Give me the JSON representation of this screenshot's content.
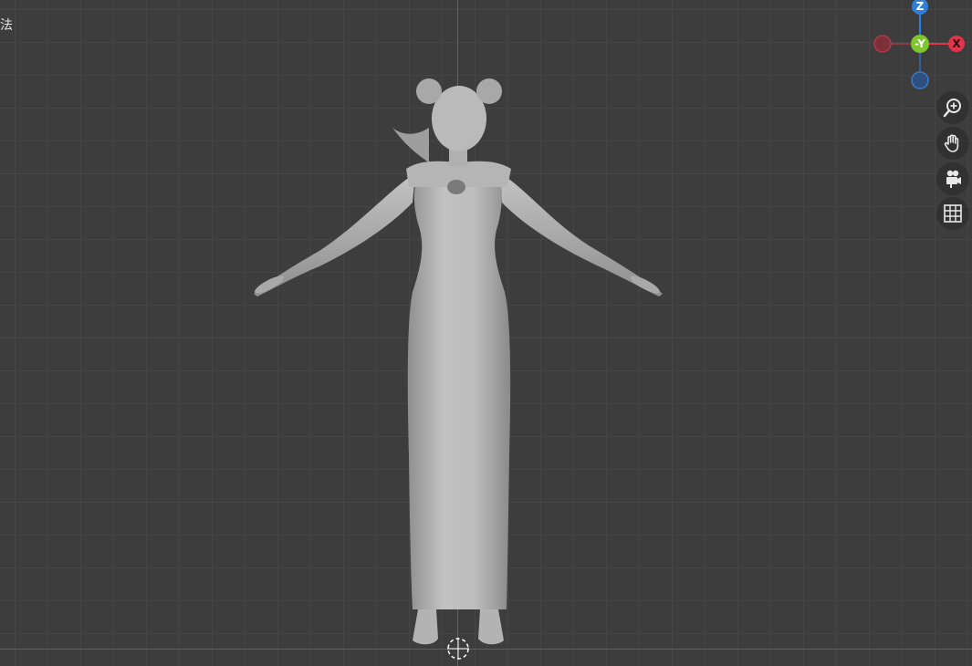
{
  "viewport": {
    "mode_label": "法",
    "colors": {
      "background": "#3d3d3d",
      "axis_x": "#b03a48",
      "axis_z": "#2f6fb0",
      "model": "#b8b8b8"
    }
  },
  "gizmo": {
    "z_label": "Z",
    "neg_y_label": "-Y",
    "x_label": "X",
    "colors": {
      "z": "#2f7ed8",
      "y": "#7fc52e",
      "x": "#e0364a"
    }
  },
  "nav": {
    "zoom_icon": "zoom-icon",
    "pan_icon": "hand-icon",
    "camera_icon": "camera-icon",
    "grid_icon": "grid-icon"
  }
}
